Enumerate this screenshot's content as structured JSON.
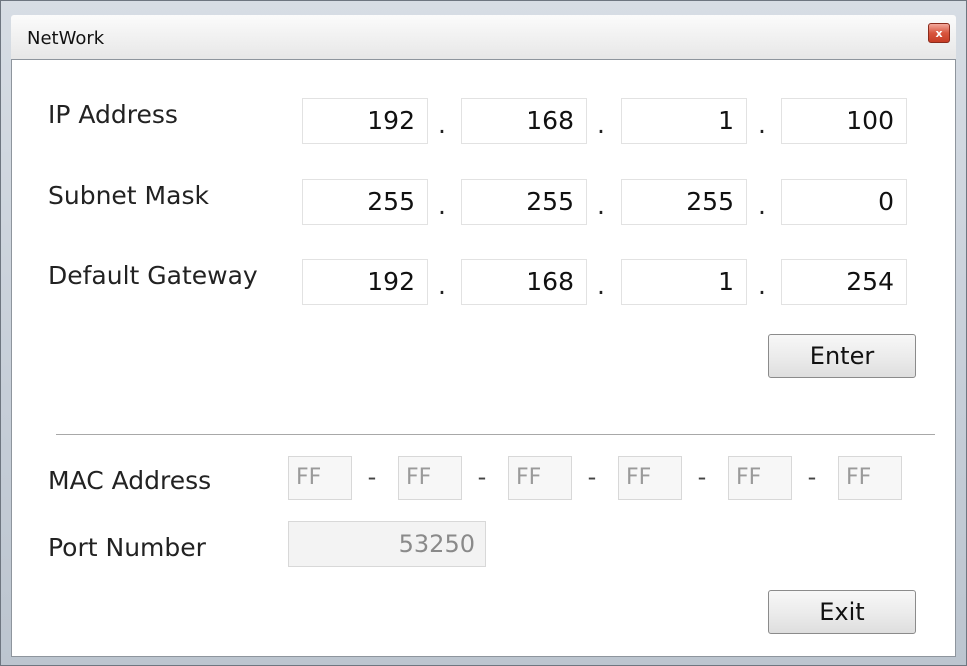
{
  "window": {
    "title": "NetWork",
    "close_label": "x"
  },
  "ip_address": {
    "label": "IP Address",
    "octets": [
      "192",
      "168",
      "1",
      "100"
    ],
    "separator": "."
  },
  "subnet_mask": {
    "label": "Subnet Mask",
    "octets": [
      "255",
      "255",
      "255",
      "0"
    ],
    "separator": "."
  },
  "default_gateway": {
    "label": "Default Gateway",
    "octets": [
      "192",
      "168",
      "1",
      "254"
    ],
    "separator": "."
  },
  "enter_button": {
    "label": "Enter"
  },
  "mac_address": {
    "label": "MAC Address",
    "bytes": [
      "FF",
      "FF",
      "FF",
      "FF",
      "FF",
      "FF"
    ],
    "separator": "-"
  },
  "port_number": {
    "label": "Port Number",
    "value": "53250"
  },
  "exit_button": {
    "label": "Exit"
  },
  "colors": {
    "close_button": "#d8553e",
    "disabled_text": "#9a9a9a"
  }
}
